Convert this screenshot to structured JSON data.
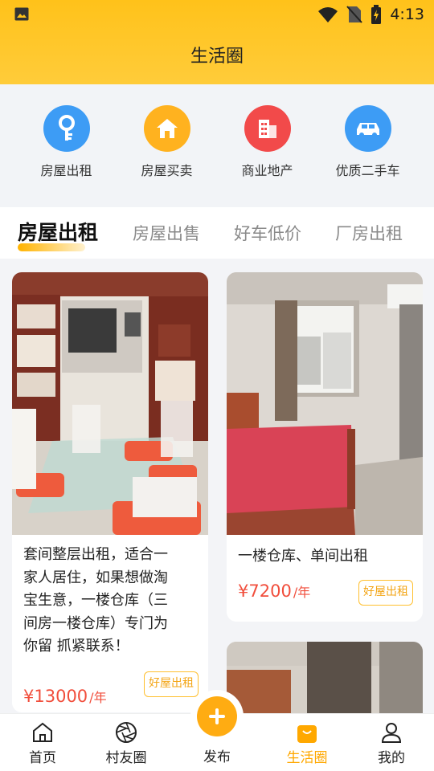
{
  "status_bar": {
    "time": "4:13"
  },
  "header": {
    "title": "生活圈"
  },
  "categories": [
    {
      "label": "房屋出租",
      "icon": "key-icon",
      "color": "#3d9cf5"
    },
    {
      "label": "房屋买卖",
      "icon": "house-icon",
      "color": "#ffb21f"
    },
    {
      "label": "商业地产",
      "icon": "building-icon",
      "color": "#f24a4a"
    },
    {
      "label": "优质二手车",
      "icon": "car-icon",
      "color": "#3d9cf5"
    }
  ],
  "tabs": [
    {
      "label": "房屋出租",
      "active": true
    },
    {
      "label": "房屋出售",
      "active": false
    },
    {
      "label": "好车低价",
      "active": false
    },
    {
      "label": "厂房出租",
      "active": false
    }
  ],
  "listings": [
    {
      "desc_lines": [
        "套间整层出租，适合一",
        "家人居住，如果想做淘",
        "宝生意，一楼仓库（三",
        "间房一楼仓库）专门为",
        "你留 抓紧联系！"
      ],
      "price": "¥13000",
      "unit": "/年",
      "tag": "好屋出租"
    },
    {
      "desc_lines": [
        "一楼仓库、单间出租"
      ],
      "price": "¥7200",
      "unit": "/年",
      "tag": "好屋出租"
    }
  ],
  "nav": {
    "home": "首页",
    "village": "村友圈",
    "publish": "发布",
    "life": "生活圈",
    "mine": "我的"
  },
  "colors": {
    "accent": "#ffb300",
    "price": "#f14e3c"
  }
}
